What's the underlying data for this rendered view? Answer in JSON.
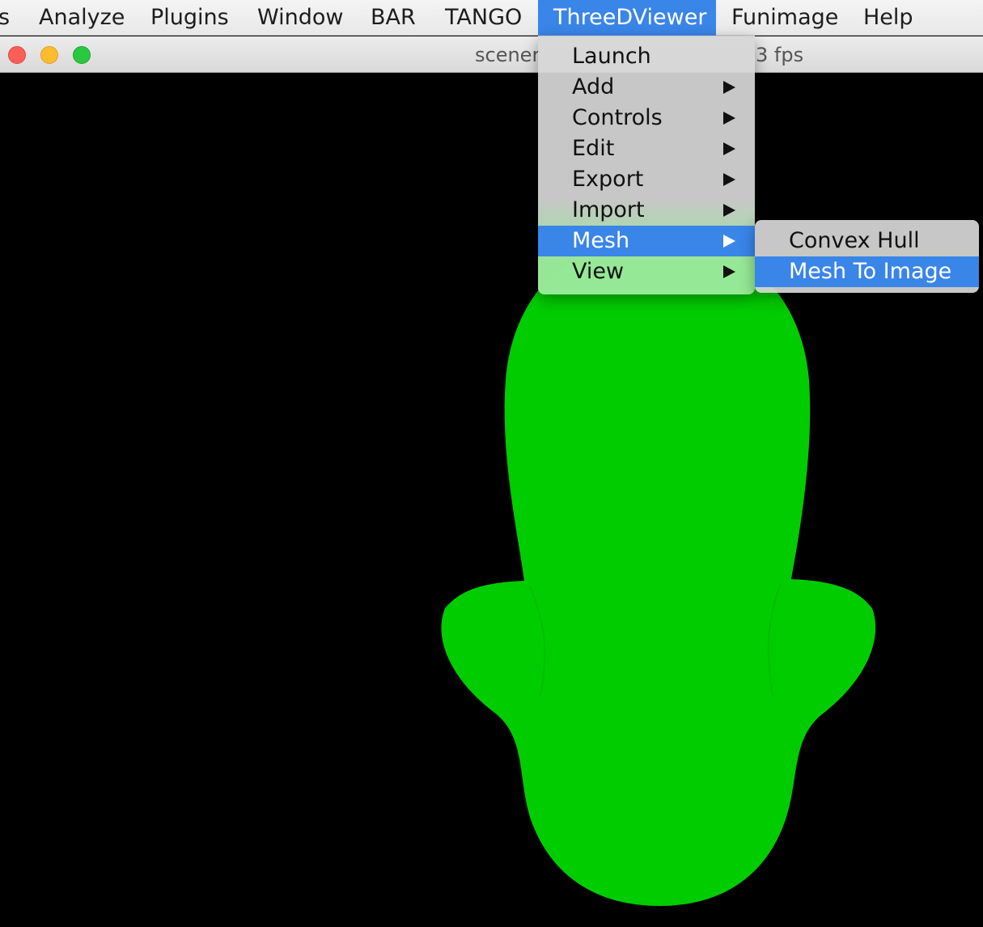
{
  "menubar": {
    "items": [
      {
        "label": "s"
      },
      {
        "label": "Analyze"
      },
      {
        "label": "Plugins"
      },
      {
        "label": "Window"
      },
      {
        "label": "BAR"
      },
      {
        "label": "TANGO"
      },
      {
        "label": "ThreeDViewer"
      },
      {
        "label": "Funimage"
      },
      {
        "label": "Help"
      }
    ],
    "active": "ThreeDViewer"
  },
  "window": {
    "title_left": "scener",
    "title_right": "3 fps",
    "close_color": "#fc5f57",
    "minimize_color": "#fdbc2e",
    "zoom_color": "#28c840"
  },
  "viewer": {
    "background": "#000000",
    "mesh_color": "#00cc00"
  },
  "menu": {
    "items": [
      {
        "label": "Launch",
        "has_submenu": false
      },
      {
        "label": "Add",
        "has_submenu": true
      },
      {
        "label": "Controls",
        "has_submenu": true
      },
      {
        "label": "Edit",
        "has_submenu": true
      },
      {
        "label": "Export",
        "has_submenu": true
      },
      {
        "label": "Import",
        "has_submenu": true
      },
      {
        "label": "Mesh",
        "has_submenu": true,
        "highlighted": true
      },
      {
        "label": "View",
        "has_submenu": true
      }
    ]
  },
  "submenu": {
    "items": [
      {
        "label": "Convex Hull"
      },
      {
        "label": "Mesh To Image",
        "highlighted": true
      }
    ]
  },
  "colors": {
    "accent": "#3a85e8"
  }
}
